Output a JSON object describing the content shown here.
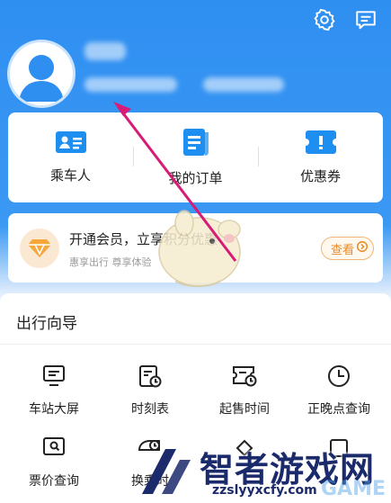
{
  "header": {
    "icons": [
      "settings-icon",
      "message-icon"
    ]
  },
  "quick_actions": [
    {
      "label": "乘车人",
      "icon": "passenger-card-icon"
    },
    {
      "label": "我的订单",
      "icon": "order-document-icon"
    },
    {
      "label": "优惠券",
      "icon": "coupon-icon"
    }
  ],
  "member_banner": {
    "title": "开通会员，立享积分优惠",
    "subtitle": "惠享出行 尊享体验",
    "button_label": "查看"
  },
  "travel_guide": {
    "title": "出行向导",
    "items": [
      {
        "label": "车站大屏",
        "icon": "station-screen-icon"
      },
      {
        "label": "时刻表",
        "icon": "timetable-icon"
      },
      {
        "label": "起售时间",
        "icon": "sale-time-icon"
      },
      {
        "label": "正晚点查询",
        "icon": "clock-icon"
      },
      {
        "label": "票价查询",
        "icon": "fare-search-icon"
      },
      {
        "label": "换乘时",
        "icon": "transfer-icon"
      },
      {
        "label": "",
        "icon": "more-icon"
      },
      {
        "label": "",
        "icon": "more-icon"
      }
    ]
  },
  "watermark": {
    "title": "智者游戏网",
    "url": "zzslyyxcfy.com",
    "overlay_text": "GAME"
  },
  "colors": {
    "brand_blue": "#2f8ff1",
    "icon_blue": "#1e8ef0",
    "member_orange": "#e98a23",
    "arrow_magenta": "#d81b77"
  }
}
